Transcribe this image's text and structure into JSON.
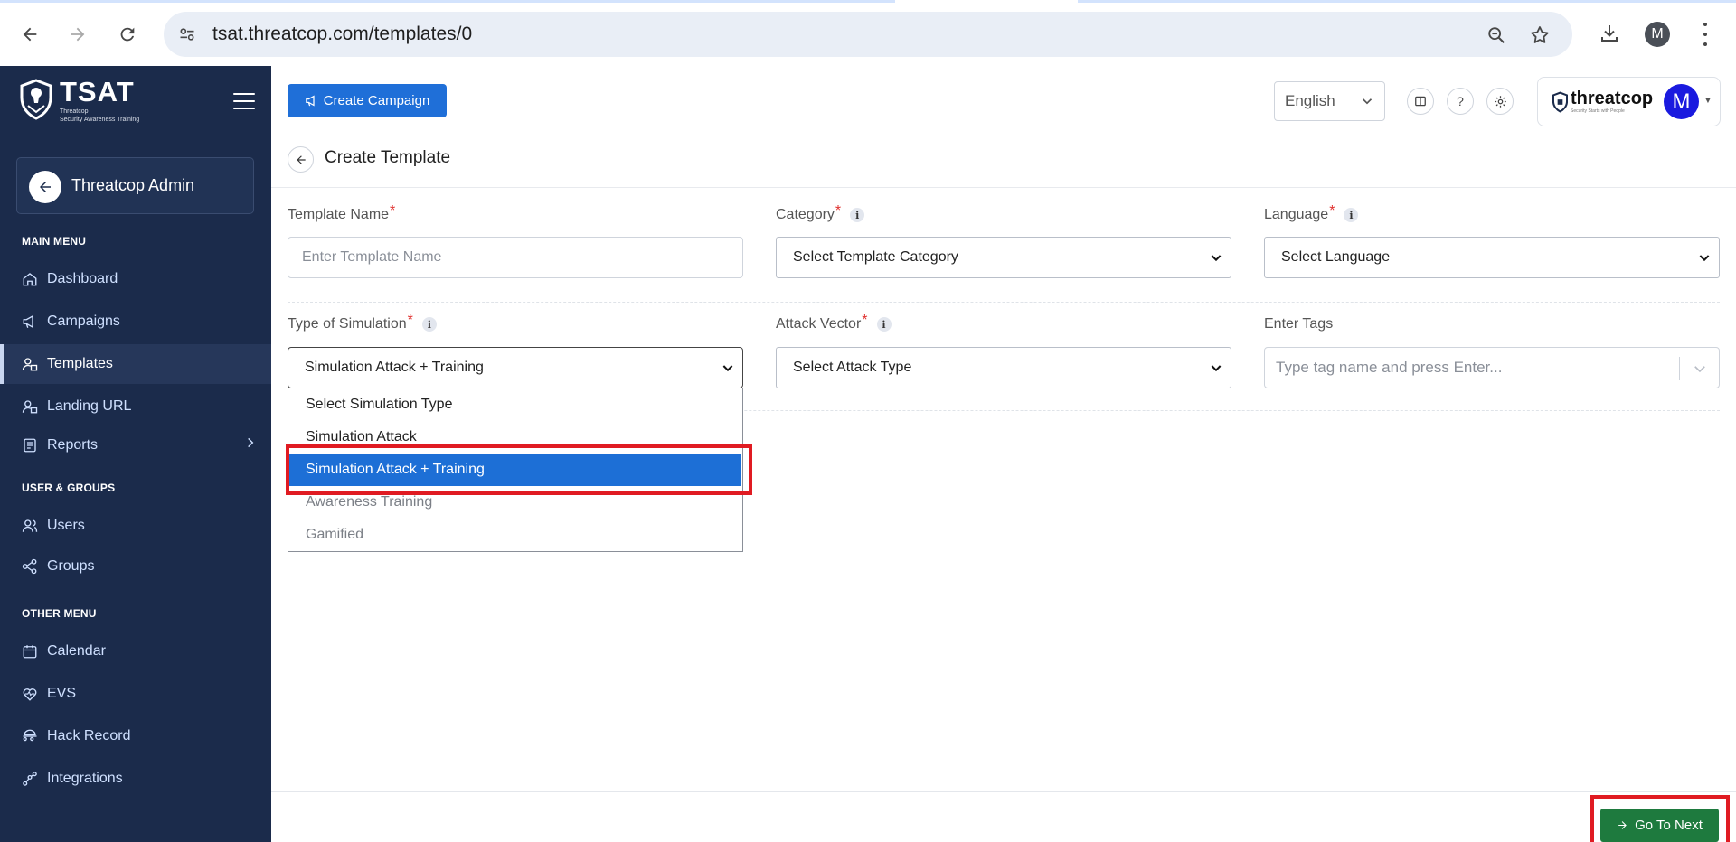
{
  "browser": {
    "url": "tsat.threatcop.com/templates/0",
    "profile_initial": "M"
  },
  "sidebar": {
    "brand": "TSAT",
    "brand_sub_line1": "Threatcop",
    "brand_sub_line2": "Security Awareness Training",
    "admin_label": "Threatcop Admin",
    "sections": {
      "main_menu": "MAIN MENU",
      "user_groups": "USER & GROUPS",
      "other_menu": "OTHER MENU"
    },
    "items": [
      {
        "label": "Dashboard"
      },
      {
        "label": "Campaigns"
      },
      {
        "label": "Templates"
      },
      {
        "label": "Landing URL"
      },
      {
        "label": "Reports"
      },
      {
        "label": "Users"
      },
      {
        "label": "Groups"
      },
      {
        "label": "Calendar"
      },
      {
        "label": "EVS"
      },
      {
        "label": "Hack Record"
      },
      {
        "label": "Integrations"
      }
    ],
    "active_item": "Templates"
  },
  "header": {
    "create_campaign": "Create Campaign",
    "language": "English",
    "help_symbol": "?",
    "company_logo_text": "threatcop",
    "company_logo_tagline": "Security Starts with People",
    "avatar_initial": "M"
  },
  "page": {
    "title": "Create Template"
  },
  "form": {
    "template_name": {
      "label": "Template Name",
      "required": "*",
      "placeholder": "Enter Template Name"
    },
    "category": {
      "label": "Category",
      "required": "*",
      "info": "i",
      "value": "Select Template Category"
    },
    "language": {
      "label": "Language",
      "required": "*",
      "info": "i",
      "value": "Select Language"
    },
    "simulation_type": {
      "label": "Type of Simulation",
      "required": "*",
      "info": "i",
      "value": "Simulation Attack + Training",
      "options": [
        {
          "label": "Select Simulation Type"
        },
        {
          "label": "Simulation Attack"
        },
        {
          "label": "Simulation Attack + Training"
        },
        {
          "label": "Awareness Training"
        },
        {
          "label": "Gamified"
        }
      ],
      "selected_index": 2
    },
    "attack_vector": {
      "label": "Attack Vector",
      "required": "*",
      "info": "i",
      "value": "Select Attack Type"
    },
    "tags": {
      "label": "Enter Tags",
      "placeholder": "Type tag name and press Enter..."
    }
  },
  "footer": {
    "next_button": "Go To Next"
  },
  "colors": {
    "sidebar_bg": "#1b2b4b",
    "primary_button": "#1f6fd8",
    "next_button": "#1e7a3e",
    "selected_option": "#1d6fd6",
    "required_mark": "#e0302e",
    "highlight_annotation": "#e01b22"
  }
}
